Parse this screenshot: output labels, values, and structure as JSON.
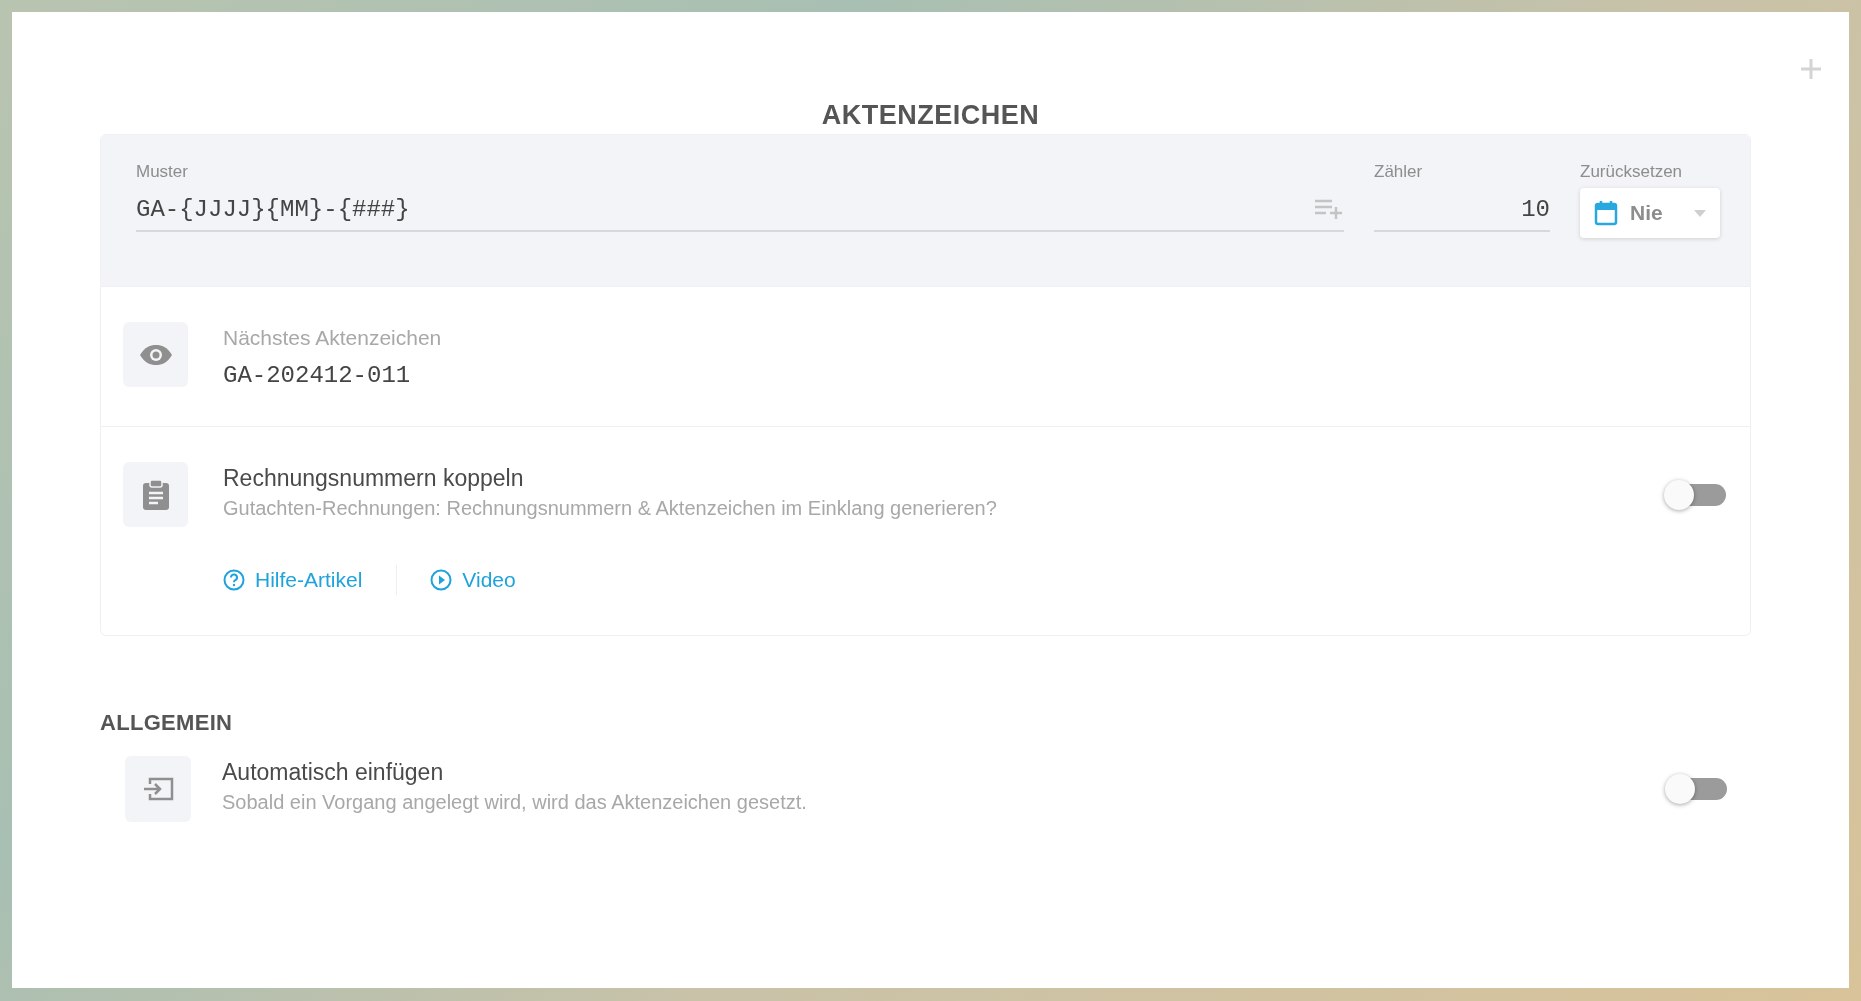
{
  "dialog": {
    "title": "AKTENZEICHEN"
  },
  "pattern": {
    "label": "Muster",
    "value": "GA-{JJJJ}{MM}-{###}"
  },
  "counter": {
    "label": "Zähler",
    "value": "10"
  },
  "reset": {
    "label": "Zurücksetzen",
    "value": "Nie"
  },
  "preview": {
    "label": "Nächstes Aktenzeichen",
    "value": "GA-202412-011"
  },
  "link_invoices": {
    "title": "Rechnungsnummern koppeln",
    "description": "Gutachten-Rechnungen: Rechnungsnummern & Aktenzeichen im Einklang generieren?",
    "on": false,
    "links": [
      {
        "label": "Hilfe-Artikel",
        "kind": "help"
      },
      {
        "label": "Video",
        "kind": "video"
      }
    ]
  },
  "section": {
    "title": "ALLGEMEIN"
  },
  "auto_insert": {
    "title": "Automatisch einfügen",
    "description": "Sobald ein Vorgang angelegt wird, wird das Aktenzeichen gesetzt.",
    "on": false
  }
}
